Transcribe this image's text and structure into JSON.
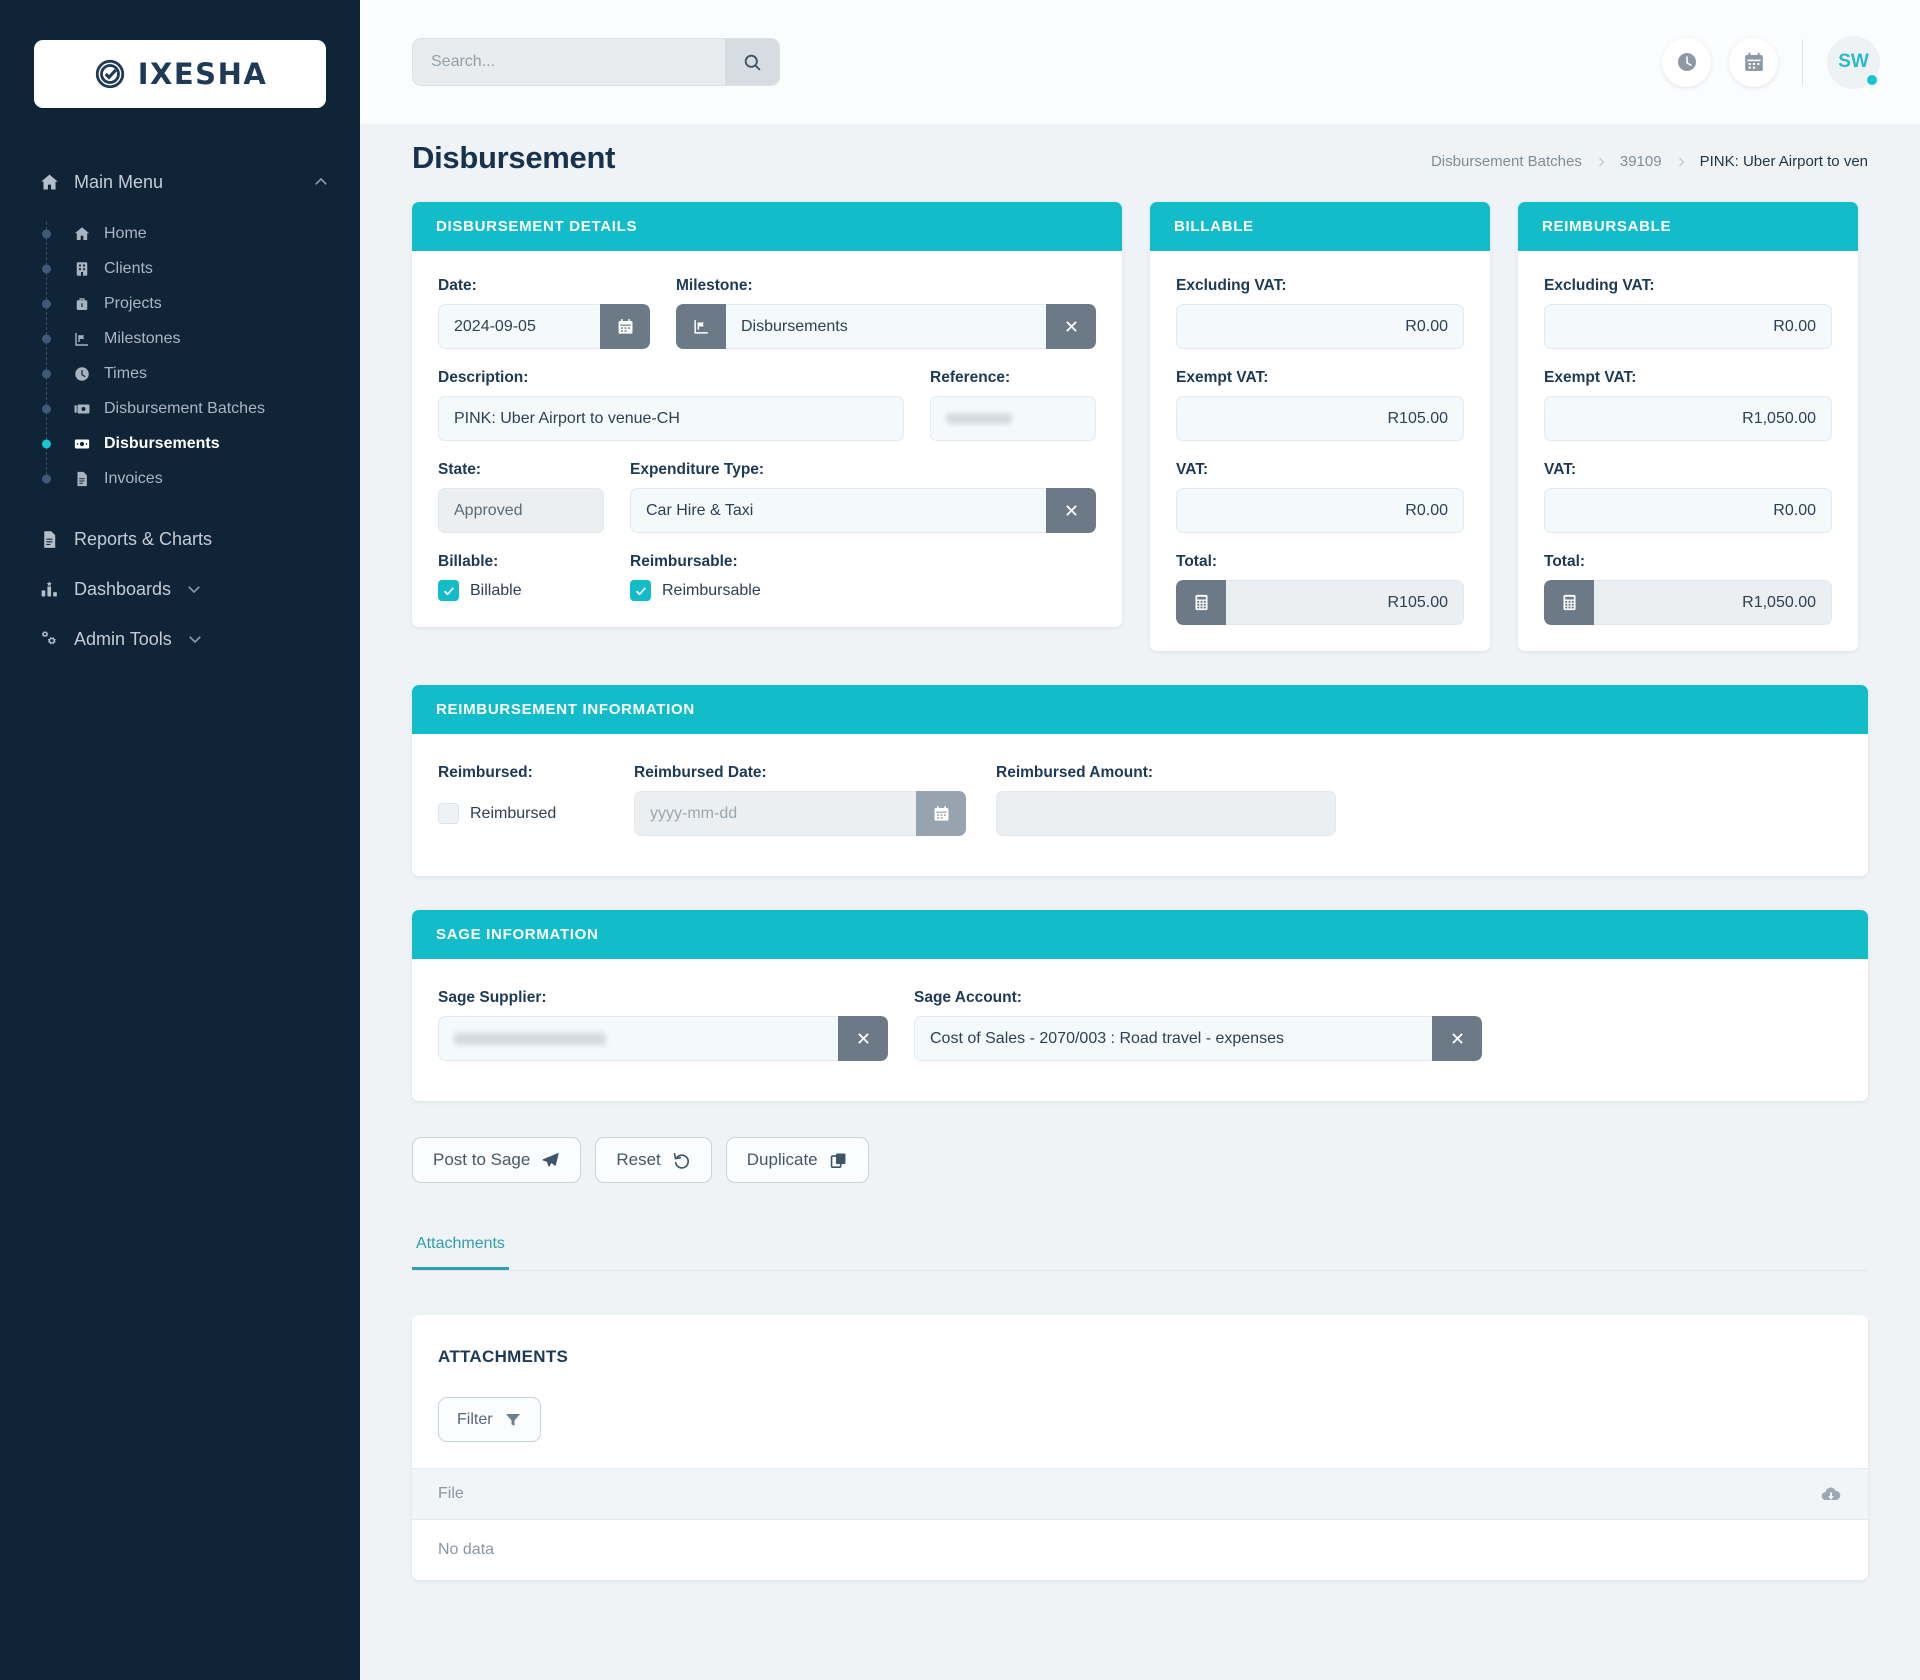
{
  "brand": {
    "name": "IXESHA",
    "accent": "#12bdc9",
    "sidebar_bg": "#102437"
  },
  "search": {
    "placeholder": "Search...",
    "value": ""
  },
  "topbar": {
    "clock_icon": "clock-icon",
    "calendar_icon": "calendar-icon",
    "avatar_initials": "SW"
  },
  "sidebar": {
    "main_menu": {
      "label": "Main Menu",
      "icon": "home-icon",
      "expanded": true,
      "items": [
        {
          "label": "Home",
          "icon": "home-icon",
          "active": false
        },
        {
          "label": "Clients",
          "icon": "building-icon",
          "active": false
        },
        {
          "label": "Projects",
          "icon": "briefcase-icon",
          "active": false
        },
        {
          "label": "Milestones",
          "icon": "chart-flag-icon",
          "active": false
        },
        {
          "label": "Times",
          "icon": "clock-icon",
          "active": false
        },
        {
          "label": "Disbursement Batches",
          "icon": "money-stack-icon",
          "active": false
        },
        {
          "label": "Disbursements",
          "icon": "money-icon",
          "active": true
        },
        {
          "label": "Invoices",
          "icon": "document-icon",
          "active": false
        }
      ]
    },
    "groups": [
      {
        "label": "Reports & Charts",
        "icon": "report-icon",
        "chevron": false
      },
      {
        "label": "Dashboards",
        "icon": "bar-chart-icon",
        "chevron": true
      },
      {
        "label": "Admin Tools",
        "icon": "gears-icon",
        "chevron": true
      }
    ]
  },
  "page": {
    "title": "Disbursement",
    "breadcrumb": [
      {
        "label": "Disbursement Batches",
        "current": false
      },
      {
        "label": "39109",
        "current": false
      },
      {
        "label": "PINK: Uber Airport to ven",
        "current": true
      }
    ]
  },
  "details": {
    "header": "DISBURSEMENT DETAILS",
    "date_label": "Date:",
    "date_value": "2024-09-05",
    "milestone_label": "Milestone:",
    "milestone_value": "Disbursements",
    "description_label": "Description:",
    "description_value": "PINK: Uber Airport to venue-CH",
    "reference_label": "Reference:",
    "reference_value": "",
    "state_label": "State:",
    "state_value": "Approved",
    "expenditure_label": "Expenditure Type:",
    "expenditure_value": "Car Hire & Taxi",
    "billable_label": "Billable:",
    "billable_checkbox_label": "Billable",
    "billable_checked": true,
    "reimbursable_label": "Reimbursable:",
    "reimbursable_checkbox_label": "Reimbursable",
    "reimbursable_checked": true
  },
  "billable": {
    "header": "BILLABLE",
    "excluding_vat_label": "Excluding VAT:",
    "excluding_vat_value": "R0.00",
    "exempt_vat_label": "Exempt VAT:",
    "exempt_vat_value": "R105.00",
    "vat_label": "VAT:",
    "vat_value": "R0.00",
    "total_label": "Total:",
    "total_value": "R105.00"
  },
  "reimbursable": {
    "header": "REIMBURSABLE",
    "excluding_vat_label": "Excluding VAT:",
    "excluding_vat_value": "R0.00",
    "exempt_vat_label": "Exempt VAT:",
    "exempt_vat_value": "R1,050.00",
    "vat_label": "VAT:",
    "vat_value": "R0.00",
    "total_label": "Total:",
    "total_value": "R1,050.00"
  },
  "reimbursement": {
    "header": "REIMBURSEMENT INFORMATION",
    "reimbursed_label": "Reimbursed:",
    "reimbursed_checkbox_label": "Reimbursed",
    "reimbursed_checked": false,
    "date_label": "Reimbursed Date:",
    "date_placeholder": "yyyy-mm-dd",
    "date_value": "",
    "amount_label": "Reimbursed Amount:",
    "amount_value": ""
  },
  "sage": {
    "header": "SAGE INFORMATION",
    "supplier_label": "Sage Supplier:",
    "supplier_value": "",
    "account_label": "Sage Account:",
    "account_value": "Cost of Sales - 2070/003 : Road travel - expenses"
  },
  "actions": {
    "post_to_sage": "Post to Sage",
    "reset": "Reset",
    "duplicate": "Duplicate"
  },
  "tabs": [
    {
      "label": "Attachments",
      "active": true
    }
  ],
  "attachments": {
    "title": "ATTACHMENTS",
    "filter_label": "Filter",
    "columns": [
      "File"
    ],
    "empty_text": "No data",
    "download_icon": "cloud-download-icon"
  }
}
